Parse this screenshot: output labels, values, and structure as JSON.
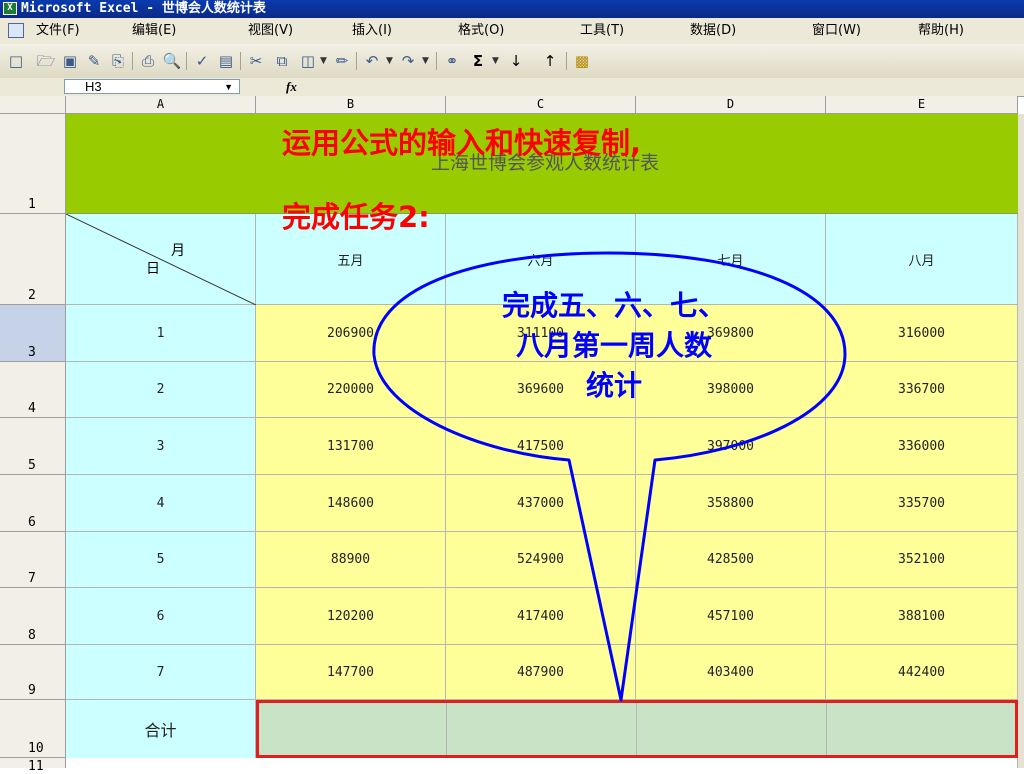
{
  "window": {
    "title": "Microsoft Excel - 世博会人数统计表"
  },
  "menu": {
    "items": [
      "文件(F)",
      "编辑(E)",
      "视图(V)",
      "插入(I)",
      "格式(O)",
      "工具(T)",
      "数据(D)",
      "窗口(W)",
      "帮助(H)"
    ]
  },
  "toolbar": {
    "icons": [
      "new-icon",
      "open-icon",
      "save-icon",
      "permission-icon",
      "print-icon",
      "print-preview-icon",
      "spelling-icon",
      "research-icon",
      "cut-icon",
      "copy-icon",
      "paste-icon",
      "format-painter-icon",
      "undo-icon",
      "redo-icon",
      "hyperlink-icon",
      "autosum-icon",
      "sort-ascending-icon",
      "sort-descending-icon",
      "chart-wizard-icon"
    ]
  },
  "formula_bar": {
    "name_box": "H3",
    "fx_label": "fx"
  },
  "grid": {
    "columns": [
      "A",
      "B",
      "C",
      "D",
      "E"
    ],
    "row_numbers": [
      "1",
      "2",
      "3",
      "4",
      "5",
      "6",
      "7",
      "8",
      "9",
      "10",
      "11"
    ],
    "selected_row": "3",
    "table_title": "上海世博会参观人数统计表",
    "header": {
      "month_label": "月",
      "day_label": "日",
      "months": [
        "五月",
        "六月",
        "七月",
        "八月"
      ]
    },
    "rows": [
      {
        "day": "1",
        "values": [
          "206900",
          "311100",
          "369800",
          "316000"
        ]
      },
      {
        "day": "2",
        "values": [
          "220000",
          "369600",
          "398000",
          "336700"
        ]
      },
      {
        "day": "3",
        "values": [
          "131700",
          "417500",
          "397000",
          "336000"
        ]
      },
      {
        "day": "4",
        "values": [
          "148600",
          "437000",
          "358800",
          "335700"
        ]
      },
      {
        "day": "5",
        "values": [
          "88900",
          "524900",
          "428500",
          "352100"
        ]
      },
      {
        "day": "6",
        "values": [
          "120200",
          "417400",
          "457100",
          "388100"
        ]
      },
      {
        "day": "7",
        "values": [
          "147700",
          "487900",
          "403400",
          "442400"
        ]
      }
    ],
    "total_label": "合计"
  },
  "annotations": {
    "line1": "运用公式的输入和快速复制,",
    "line2": "完成任务2:",
    "bubble_lines": [
      "完成五、六、七、",
      "八月第一周人数",
      "统计"
    ]
  },
  "colors": {
    "title_bar": "#0b3399",
    "title_row": "#99cc00",
    "day_cells": "#ccffff",
    "value_cells": "#ffff99",
    "total_cells": "#c9e3c7",
    "highlight_border": "#e02020",
    "annotation_red": "#ff0000",
    "bubble_blue": "#0000ff"
  }
}
